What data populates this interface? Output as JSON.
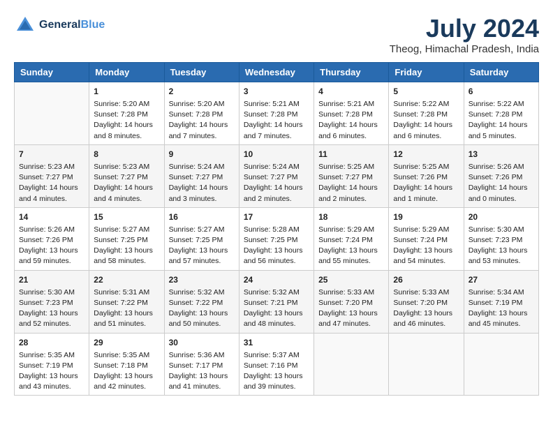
{
  "header": {
    "logo_line1": "General",
    "logo_line2": "Blue",
    "month_year": "July 2024",
    "location": "Theog, Himachal Pradesh, India"
  },
  "columns": [
    "Sunday",
    "Monday",
    "Tuesday",
    "Wednesday",
    "Thursday",
    "Friday",
    "Saturday"
  ],
  "weeks": [
    [
      {
        "day": "",
        "text": ""
      },
      {
        "day": "1",
        "text": "Sunrise: 5:20 AM\nSunset: 7:28 PM\nDaylight: 14 hours\nand 8 minutes."
      },
      {
        "day": "2",
        "text": "Sunrise: 5:20 AM\nSunset: 7:28 PM\nDaylight: 14 hours\nand 7 minutes."
      },
      {
        "day": "3",
        "text": "Sunrise: 5:21 AM\nSunset: 7:28 PM\nDaylight: 14 hours\nand 7 minutes."
      },
      {
        "day": "4",
        "text": "Sunrise: 5:21 AM\nSunset: 7:28 PM\nDaylight: 14 hours\nand 6 minutes."
      },
      {
        "day": "5",
        "text": "Sunrise: 5:22 AM\nSunset: 7:28 PM\nDaylight: 14 hours\nand 6 minutes."
      },
      {
        "day": "6",
        "text": "Sunrise: 5:22 AM\nSunset: 7:28 PM\nDaylight: 14 hours\nand 5 minutes."
      }
    ],
    [
      {
        "day": "7",
        "text": "Sunrise: 5:23 AM\nSunset: 7:27 PM\nDaylight: 14 hours\nand 4 minutes."
      },
      {
        "day": "8",
        "text": "Sunrise: 5:23 AM\nSunset: 7:27 PM\nDaylight: 14 hours\nand 4 minutes."
      },
      {
        "day": "9",
        "text": "Sunrise: 5:24 AM\nSunset: 7:27 PM\nDaylight: 14 hours\nand 3 minutes."
      },
      {
        "day": "10",
        "text": "Sunrise: 5:24 AM\nSunset: 7:27 PM\nDaylight: 14 hours\nand 2 minutes."
      },
      {
        "day": "11",
        "text": "Sunrise: 5:25 AM\nSunset: 7:27 PM\nDaylight: 14 hours\nand 2 minutes."
      },
      {
        "day": "12",
        "text": "Sunrise: 5:25 AM\nSunset: 7:26 PM\nDaylight: 14 hours\nand 1 minute."
      },
      {
        "day": "13",
        "text": "Sunrise: 5:26 AM\nSunset: 7:26 PM\nDaylight: 14 hours\nand 0 minutes."
      }
    ],
    [
      {
        "day": "14",
        "text": "Sunrise: 5:26 AM\nSunset: 7:26 PM\nDaylight: 13 hours\nand 59 minutes."
      },
      {
        "day": "15",
        "text": "Sunrise: 5:27 AM\nSunset: 7:25 PM\nDaylight: 13 hours\nand 58 minutes."
      },
      {
        "day": "16",
        "text": "Sunrise: 5:27 AM\nSunset: 7:25 PM\nDaylight: 13 hours\nand 57 minutes."
      },
      {
        "day": "17",
        "text": "Sunrise: 5:28 AM\nSunset: 7:25 PM\nDaylight: 13 hours\nand 56 minutes."
      },
      {
        "day": "18",
        "text": "Sunrise: 5:29 AM\nSunset: 7:24 PM\nDaylight: 13 hours\nand 55 minutes."
      },
      {
        "day": "19",
        "text": "Sunrise: 5:29 AM\nSunset: 7:24 PM\nDaylight: 13 hours\nand 54 minutes."
      },
      {
        "day": "20",
        "text": "Sunrise: 5:30 AM\nSunset: 7:23 PM\nDaylight: 13 hours\nand 53 minutes."
      }
    ],
    [
      {
        "day": "21",
        "text": "Sunrise: 5:30 AM\nSunset: 7:23 PM\nDaylight: 13 hours\nand 52 minutes."
      },
      {
        "day": "22",
        "text": "Sunrise: 5:31 AM\nSunset: 7:22 PM\nDaylight: 13 hours\nand 51 minutes."
      },
      {
        "day": "23",
        "text": "Sunrise: 5:32 AM\nSunset: 7:22 PM\nDaylight: 13 hours\nand 50 minutes."
      },
      {
        "day": "24",
        "text": "Sunrise: 5:32 AM\nSunset: 7:21 PM\nDaylight: 13 hours\nand 48 minutes."
      },
      {
        "day": "25",
        "text": "Sunrise: 5:33 AM\nSunset: 7:20 PM\nDaylight: 13 hours\nand 47 minutes."
      },
      {
        "day": "26",
        "text": "Sunrise: 5:33 AM\nSunset: 7:20 PM\nDaylight: 13 hours\nand 46 minutes."
      },
      {
        "day": "27",
        "text": "Sunrise: 5:34 AM\nSunset: 7:19 PM\nDaylight: 13 hours\nand 45 minutes."
      }
    ],
    [
      {
        "day": "28",
        "text": "Sunrise: 5:35 AM\nSunset: 7:19 PM\nDaylight: 13 hours\nand 43 minutes."
      },
      {
        "day": "29",
        "text": "Sunrise: 5:35 AM\nSunset: 7:18 PM\nDaylight: 13 hours\nand 42 minutes."
      },
      {
        "day": "30",
        "text": "Sunrise: 5:36 AM\nSunset: 7:17 PM\nDaylight: 13 hours\nand 41 minutes."
      },
      {
        "day": "31",
        "text": "Sunrise: 5:37 AM\nSunset: 7:16 PM\nDaylight: 13 hours\nand 39 minutes."
      },
      {
        "day": "",
        "text": ""
      },
      {
        "day": "",
        "text": ""
      },
      {
        "day": "",
        "text": ""
      }
    ]
  ]
}
